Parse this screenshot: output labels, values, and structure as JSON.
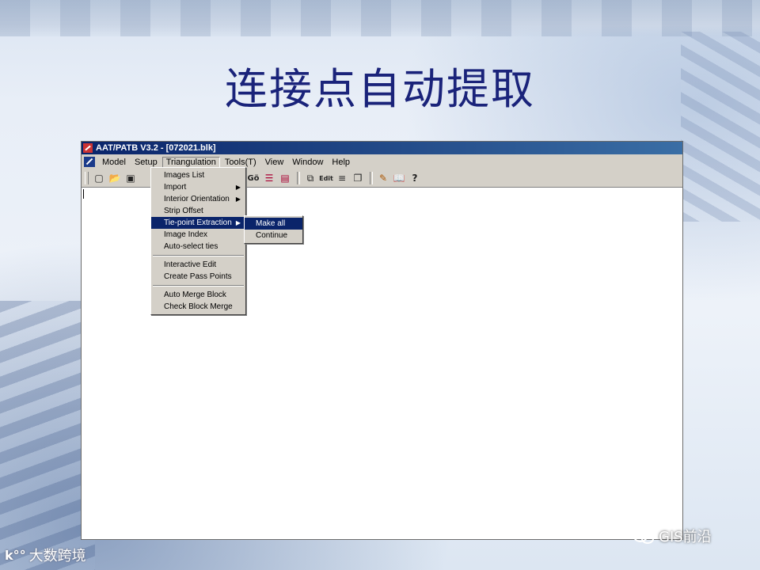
{
  "slide": {
    "title": "连接点自动提取"
  },
  "window": {
    "title": "AAT/PATB V3.2 - [072021.blk]",
    "menu": [
      {
        "label": "Model"
      },
      {
        "label": "Setup"
      },
      {
        "label": "Triangulation"
      },
      {
        "label": "Tools(T)"
      },
      {
        "label": "View"
      },
      {
        "label": "Window"
      },
      {
        "label": "Help"
      }
    ],
    "toolbar_icons": [
      "new-file-icon",
      "open-folder-icon",
      "save-icon",
      "go-icon",
      "list-icon",
      "chart-icon",
      "windows-icon",
      "edit-icon",
      "align-icon",
      "copy-icon",
      "note-icon",
      "book-icon",
      "help-icon"
    ]
  },
  "dropdown": {
    "items": [
      {
        "label": "Images List"
      },
      {
        "label": "Import"
      },
      {
        "label": "Interior Orientation"
      },
      {
        "label": "Strip Offset"
      },
      {
        "label": "Tie-point Extraction"
      },
      {
        "label": "Image Index"
      },
      {
        "label": "Auto-select ties"
      },
      {
        "label": "Interactive Edit"
      },
      {
        "label": "Create Pass Points"
      },
      {
        "label": "Auto Merge Block"
      },
      {
        "label": "Check Block Merge"
      }
    ],
    "submenu": [
      {
        "label": "Make all"
      },
      {
        "label": "Continue"
      }
    ]
  },
  "toolbar_text": {
    "go": "Gö",
    "edit": "Edit"
  },
  "watermark": {
    "left_text": "大数跨境",
    "left_logo": "k°°",
    "right_text": "GIS前沿"
  },
  "colors": {
    "title": "#1a237a",
    "titlebar": "#0a246a",
    "menu_bg": "#d4d0c8",
    "highlight": "#0a246a"
  }
}
